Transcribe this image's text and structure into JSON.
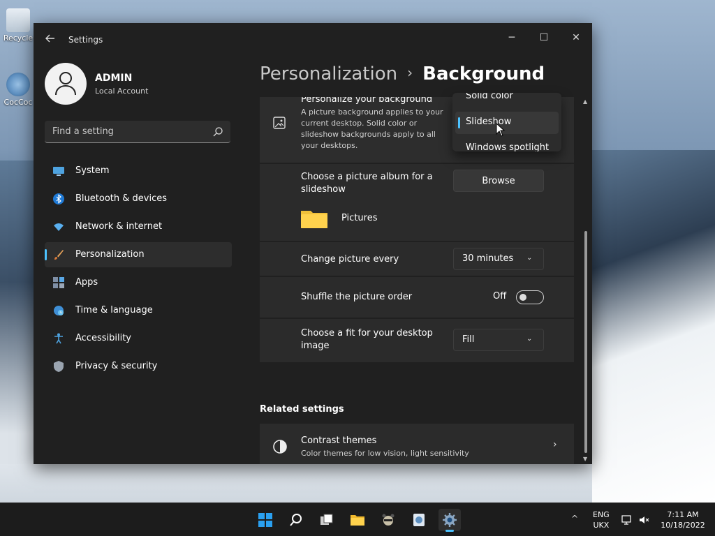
{
  "desktop": {
    "icons": [
      {
        "label": "Recycle"
      },
      {
        "label": "CocCoc"
      }
    ]
  },
  "window": {
    "title": "Settings",
    "controls": {
      "minimize": "─",
      "maximize": "☐",
      "close": "✕"
    }
  },
  "user": {
    "name": "ADMIN",
    "account_type": "Local Account"
  },
  "search": {
    "placeholder": "Find a setting"
  },
  "sidebar": {
    "items": [
      {
        "label": "System",
        "icon": "monitor-icon",
        "active": false
      },
      {
        "label": "Bluetooth & devices",
        "icon": "bluetooth-icon",
        "active": false
      },
      {
        "label": "Network & internet",
        "icon": "wifi-icon",
        "active": false
      },
      {
        "label": "Personalization",
        "icon": "paintbrush-icon",
        "active": true
      },
      {
        "label": "Apps",
        "icon": "apps-icon",
        "active": false
      },
      {
        "label": "Time & language",
        "icon": "globe-clock-icon",
        "active": false
      },
      {
        "label": "Accessibility",
        "icon": "accessibility-icon",
        "active": false
      },
      {
        "label": "Privacy & security",
        "icon": "shield-icon",
        "active": false
      }
    ]
  },
  "breadcrumb": {
    "parent": "Personalization",
    "separator": "›",
    "current": "Background"
  },
  "background_card": {
    "title": "Personalize your background",
    "description": "A picture background applies to your current desktop. Solid color or slideshow backgrounds apply to all your desktops.",
    "chevron": "›"
  },
  "dropdown_popup": {
    "options": [
      "Solid color",
      "Slideshow",
      "Windows spotlight"
    ],
    "selected": "Slideshow"
  },
  "album": {
    "label": "Choose a picture album for a slideshow",
    "browse_label": "Browse",
    "folder_name": "Pictures"
  },
  "change_picture": {
    "label": "Change picture every",
    "value": "30 minutes"
  },
  "shuffle": {
    "label": "Shuffle the picture order",
    "state_label": "Off",
    "value": false
  },
  "fit": {
    "label": "Choose a fit for your desktop image",
    "value": "Fill"
  },
  "related": {
    "title": "Related settings",
    "contrast": {
      "title": "Contrast themes",
      "description": "Color themes for low vision, light sensitivity"
    }
  },
  "taskbar": {
    "language": {
      "line1": "ENG",
      "line2": "UKX"
    },
    "time": "7:11 AM",
    "date": "10/18/2022",
    "tray_chevron": "^"
  },
  "colors": {
    "accent": "#4cc2ff",
    "window_bg": "#202020",
    "card_bg": "#2b2b2b"
  }
}
